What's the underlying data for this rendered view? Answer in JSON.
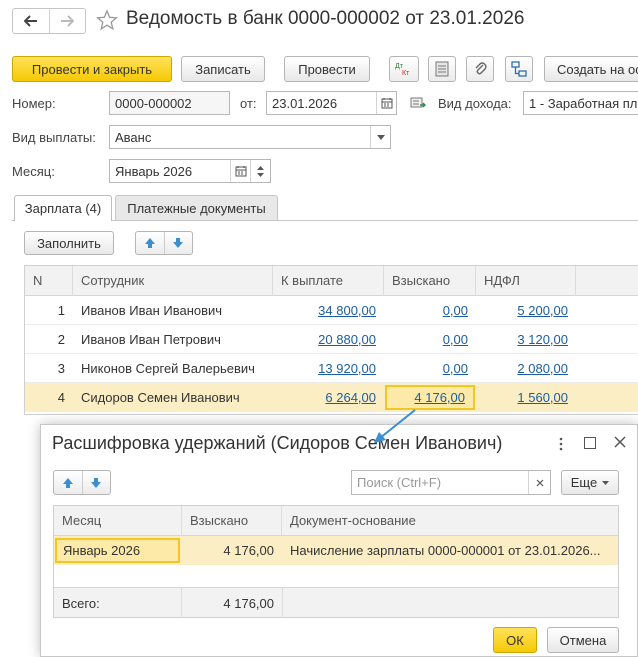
{
  "header": {
    "title": "Ведомость в банк 0000-000002 от 23.01.2026",
    "back_icon": "arrow-left-icon",
    "forward_icon": "arrow-right-icon",
    "favorite_icon": "star-icon"
  },
  "toolbar": {
    "post_close": "Провести и закрыть",
    "save": "Записать",
    "post": "Провести",
    "create_on_basis": "Создать на ос"
  },
  "form": {
    "number_label": "Номер:",
    "number_value": "0000-000002",
    "date_label": "от:",
    "date_value": "23.01.2026",
    "income_type_label": "Вид дохода:",
    "income_type_value": "1 - Заработная пл",
    "payment_type_label": "Вид выплаты:",
    "payment_type_value": "Аванс",
    "month_label": "Месяц:",
    "month_value": "Январь 2026"
  },
  "tabs": {
    "salary": "Зарплата (4)",
    "payment_docs": "Платежные документы"
  },
  "table_toolbar": {
    "fill": "Заполнить"
  },
  "table": {
    "columns": [
      "N",
      "Сотрудник",
      "К выплате",
      "Взыскано",
      "НДФЛ"
    ],
    "rows": [
      {
        "n": "1",
        "employee": "Иванов Иван Иванович",
        "payout": "34 800,00",
        "withheld": "0,00",
        "ndfl": "5 200,00"
      },
      {
        "n": "2",
        "employee": "Иванов Иван Петрович",
        "payout": "20 880,00",
        "withheld": "0,00",
        "ndfl": "3 120,00"
      },
      {
        "n": "3",
        "employee": "Никонов Сергей Валерьевич",
        "payout": "13 920,00",
        "withheld": "0,00",
        "ndfl": "2 080,00"
      },
      {
        "n": "4",
        "employee": "Сидоров Семен Иванович",
        "payout": "6 264,00",
        "withheld": "4 176,00",
        "ndfl": "1 560,00"
      }
    ]
  },
  "dialog": {
    "title": "Расшифровка удержаний (Сидоров Семен Иванович)",
    "search_placeholder": "Поиск (Ctrl+F)",
    "more": "Еще",
    "columns": [
      "Месяц",
      "Взыскано",
      "Документ-основание"
    ],
    "rows": [
      {
        "month": "Январь 2026",
        "withheld": "4 176,00",
        "document": "Начисление зарплаты 0000-000001 от 23.01.2026..."
      }
    ],
    "total_label": "Всего:",
    "total_value": "4 176,00",
    "ok": "ОК",
    "cancel": "Отмена"
  },
  "colors": {
    "accent_yellow": "#f6c905",
    "selected_row": "#fbeec5",
    "link_blue": "#1b5d9e",
    "arrow_blue": "#3b8fd0"
  }
}
